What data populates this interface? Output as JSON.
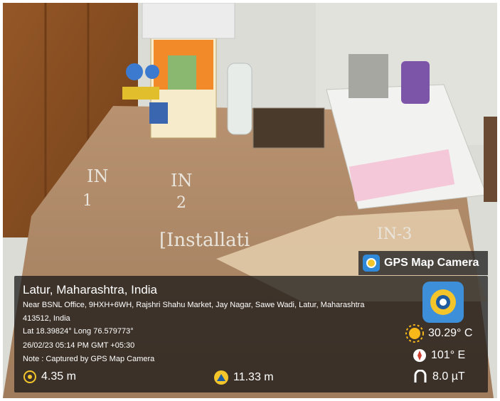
{
  "overlay": {
    "app_name": "GPS Map Camera",
    "location_title": "Latur, Maharashtra, India",
    "address": "Near BSNL Office, 9HXH+6WH, Rajshri Shahu Market, Jay Nagar, Sawe Wadi, Latur, Maharashtra 413512, India",
    "coords": "Lat 18.39824° Long 76.579773°",
    "datetime": "26/02/23 05:14 PM GMT +05:30",
    "note": "Note : Captured by GPS Map Camera",
    "accuracy": "4.35 m",
    "altitude": "11.33 m",
    "temperature": "30.29° C",
    "direction": "101° E",
    "magnetic": "8.0 µT"
  },
  "chalk": {
    "in1a": "IN",
    "in1b": "1",
    "in2a": "IN",
    "in2b": "2",
    "installation": "[Installati",
    "in3": "IN-3"
  },
  "icons": [
    "gps-camera-icon",
    "crosshair-icon",
    "altitude-icon",
    "sun-icon",
    "compass-icon",
    "magnet-icon"
  ]
}
